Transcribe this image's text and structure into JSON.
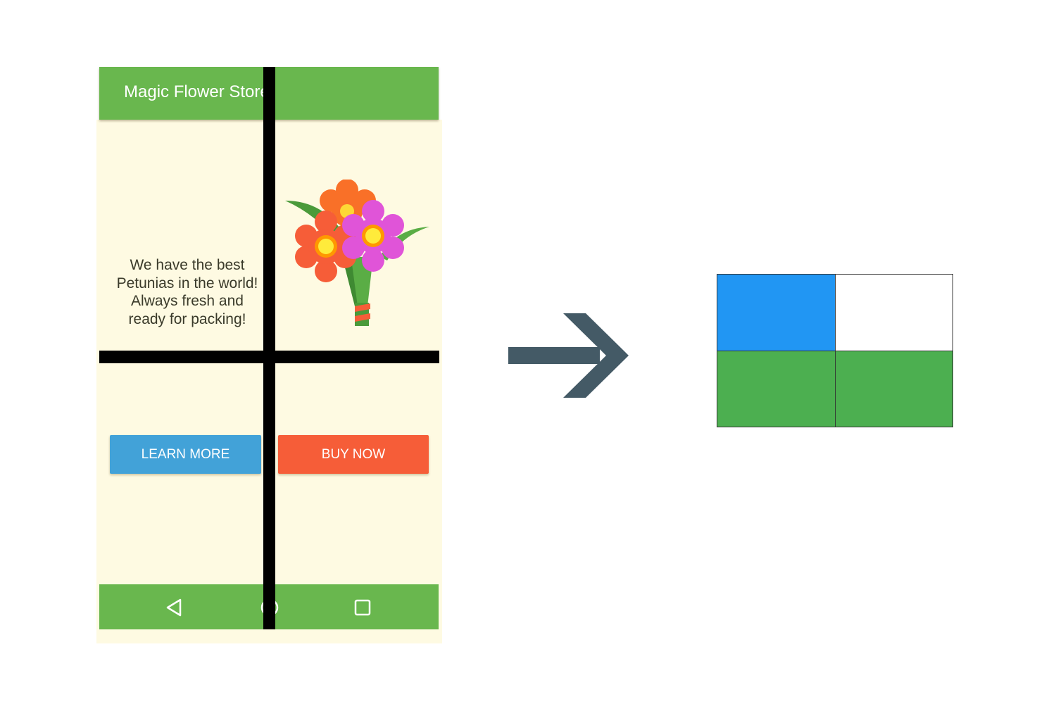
{
  "phone": {
    "app_title": "Magic Flower Store",
    "tagline_lines": [
      "We have the best",
      "Petunias in the world!",
      "Always fresh and",
      "ready for packing!"
    ],
    "learn_more_label": "LEARN MORE",
    "buy_now_label": "BUY NOW",
    "colors": {
      "app_bar": "#69b74e",
      "background": "#fefae2",
      "learn_more": "#42a2d8",
      "buy_now": "#f65d38"
    }
  },
  "nav_icons": [
    "back-icon",
    "home-icon",
    "recents-icon"
  ],
  "arrow_color": "#445a66",
  "grid_cells": [
    {
      "position": "top-left",
      "color": "#2196f3"
    },
    {
      "position": "top-right",
      "color": "#ffffff"
    },
    {
      "position": "bottom-left",
      "color": "#4caf50"
    },
    {
      "position": "bottom-right",
      "color": "#4caf50"
    }
  ]
}
